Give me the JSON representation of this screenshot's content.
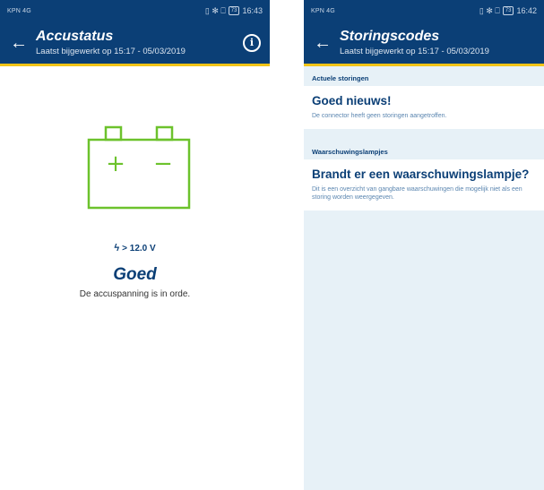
{
  "left": {
    "statusbar": {
      "carrier": "KPN 4G",
      "icons": "▯ ✻ ⎕ ",
      "battery": "73",
      "time": "16:43"
    },
    "header": {
      "back_icon": "←",
      "title": "Accustatus",
      "subtitle": "Laatst bijgewerkt op 15:17 - 05/03/2019",
      "info_icon": "i"
    },
    "battery": {
      "plus": "+",
      "minus": "−",
      "color": "#6cc22c"
    },
    "voltage": {
      "bolt": "ϟ",
      "value": "> 12.0 V"
    },
    "status": {
      "word": "Goed",
      "description": "De accuspanning is in orde."
    }
  },
  "right": {
    "statusbar": {
      "carrier": "KPN 4G",
      "icons": "▯ ✻ ⎕ ",
      "battery": "73",
      "time": "16:42"
    },
    "header": {
      "back_icon": "←",
      "title": "Storingscodes",
      "subtitle": "Laatst bijgewerkt op 15:17 - 05/03/2019"
    },
    "sections": {
      "faults": {
        "heading": "Actuele storingen",
        "title": "Goed nieuws!",
        "text": "De connector heeft geen storingen aangetroffen."
      },
      "warnings": {
        "heading": "Waarschuwingslampjes",
        "title": "Brandt er een waarschuwingslampje?",
        "text": "Dit is een overzicht van gangbare waarschuwingen die mogelijk niet als een storing worden weergegeven."
      }
    }
  },
  "colors": {
    "header": "#0b3f76",
    "accent": "#f2c417",
    "battery_green": "#6cc22c",
    "panel_bg": "#e7f1f7"
  }
}
